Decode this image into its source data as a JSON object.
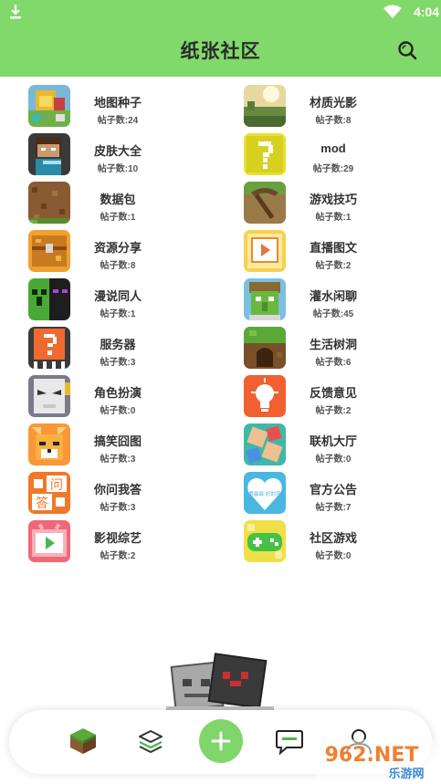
{
  "status_bar": {
    "time": "4:04"
  },
  "app_bar": {
    "title": "纸张社区"
  },
  "categories": [
    {
      "name": "地图种子",
      "count": "帖子数:24",
      "icon": "map-seed-icon"
    },
    {
      "name": "材质光影",
      "count": "帖子数:8",
      "icon": "texture-shader-icon"
    },
    {
      "name": "皮肤大全",
      "count": "帖子数:10",
      "icon": "skins-icon"
    },
    {
      "name": "mod",
      "count": "帖子数:29",
      "icon": "mod-question-block-icon"
    },
    {
      "name": "数据包",
      "count": "帖子数:1",
      "icon": "datapack-dirt-icon"
    },
    {
      "name": "游戏技巧",
      "count": "帖子数:1",
      "icon": "pickaxe-icon"
    },
    {
      "name": "资源分享",
      "count": "帖子数:8",
      "icon": "chest-icon"
    },
    {
      "name": "直播图文",
      "count": "帖子数:2",
      "icon": "live-play-icon"
    },
    {
      "name": "漫说同人",
      "count": "帖子数:1",
      "icon": "creeper-enderman-icon"
    },
    {
      "name": "灌水闲聊",
      "count": "帖子数:45",
      "icon": "villager-chat-icon"
    },
    {
      "name": "服务器",
      "count": "帖子数:3",
      "icon": "server-question-icon"
    },
    {
      "name": "生活树洞",
      "count": "帖子数:6",
      "icon": "tree-hole-icon"
    },
    {
      "name": "角色扮演",
      "count": "帖子数:0",
      "icon": "roleplay-mask-icon"
    },
    {
      "name": "反馈意见",
      "count": "帖子数:2",
      "icon": "lightbulb-icon"
    },
    {
      "name": "搞笑囧图",
      "count": "帖子数:3",
      "icon": "funny-fox-icon"
    },
    {
      "name": "联机大厅",
      "count": "帖子数:0",
      "icon": "multiplayer-lobby-icon"
    },
    {
      "name": "你问我答",
      "count": "帖子数:3",
      "icon": "qa-icon"
    },
    {
      "name": "官方公告",
      "count": "帖子数:7",
      "icon": "announcement-heart-icon"
    },
    {
      "name": "影视综艺",
      "count": "帖子数:2",
      "icon": "tv-video-icon"
    },
    {
      "name": "社区游戏",
      "count": "帖子数:0",
      "icon": "gamepad-icon"
    }
  ],
  "announcement_icon_text": "世界最最 好的官方",
  "qa_icon_chars": [
    "问",
    "答"
  ],
  "bottom_nav": {
    "items": [
      {
        "icon": "grass-block-icon"
      },
      {
        "icon": "layers-icon"
      },
      {
        "icon": "add-icon"
      },
      {
        "icon": "chat-bubble-icon"
      },
      {
        "icon": "profile-icon"
      }
    ]
  },
  "watermark": {
    "text": "962.NET",
    "sub": "乐游网"
  },
  "colors": {
    "primary": "#82d96b",
    "fab": "#7fd66a"
  }
}
